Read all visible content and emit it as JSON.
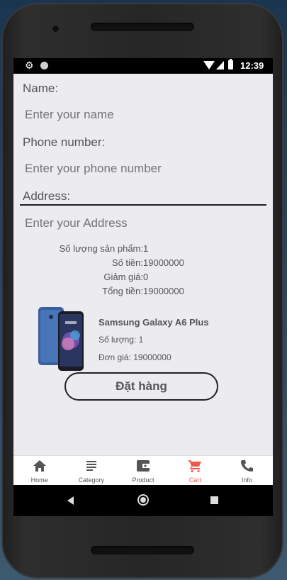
{
  "status_bar": {
    "time": "12:39",
    "settings_icon": "gear-icon",
    "notification_icon": "circle-icon"
  },
  "form": {
    "name_label": "Name:",
    "name_placeholder": "Enter your name",
    "phone_label": "Phone number:",
    "phone_placeholder": "Enter your phone number",
    "address_label": "Address:",
    "address_placeholder": "Enter your Address"
  },
  "summary": {
    "quantity_label": "Số lượng sản phẩm:",
    "quantity_value": "1",
    "amount_label": "Số tiền:",
    "amount_value": "19000000",
    "discount_label": "Giảm giá:",
    "discount_value": "0",
    "total_label": "Tổng tiền:",
    "total_value": "19000000"
  },
  "product": {
    "name": "Samsung Galaxy A6 Plus",
    "quantity": "Số lượng: 1",
    "unit_price": "Đơn giá: 19000000"
  },
  "order_button": "Đặt hàng",
  "tabs": [
    {
      "label": "Home",
      "icon": "home-icon"
    },
    {
      "label": "Category",
      "icon": "list-icon"
    },
    {
      "label": "Product",
      "icon": "wallet-icon"
    },
    {
      "label": "Cart",
      "icon": "cart-icon",
      "active": true
    },
    {
      "label": "Info",
      "icon": "phone-icon"
    }
  ],
  "colors": {
    "accent": "#f0574a",
    "background": "#ebebf0",
    "text": "#555555"
  }
}
